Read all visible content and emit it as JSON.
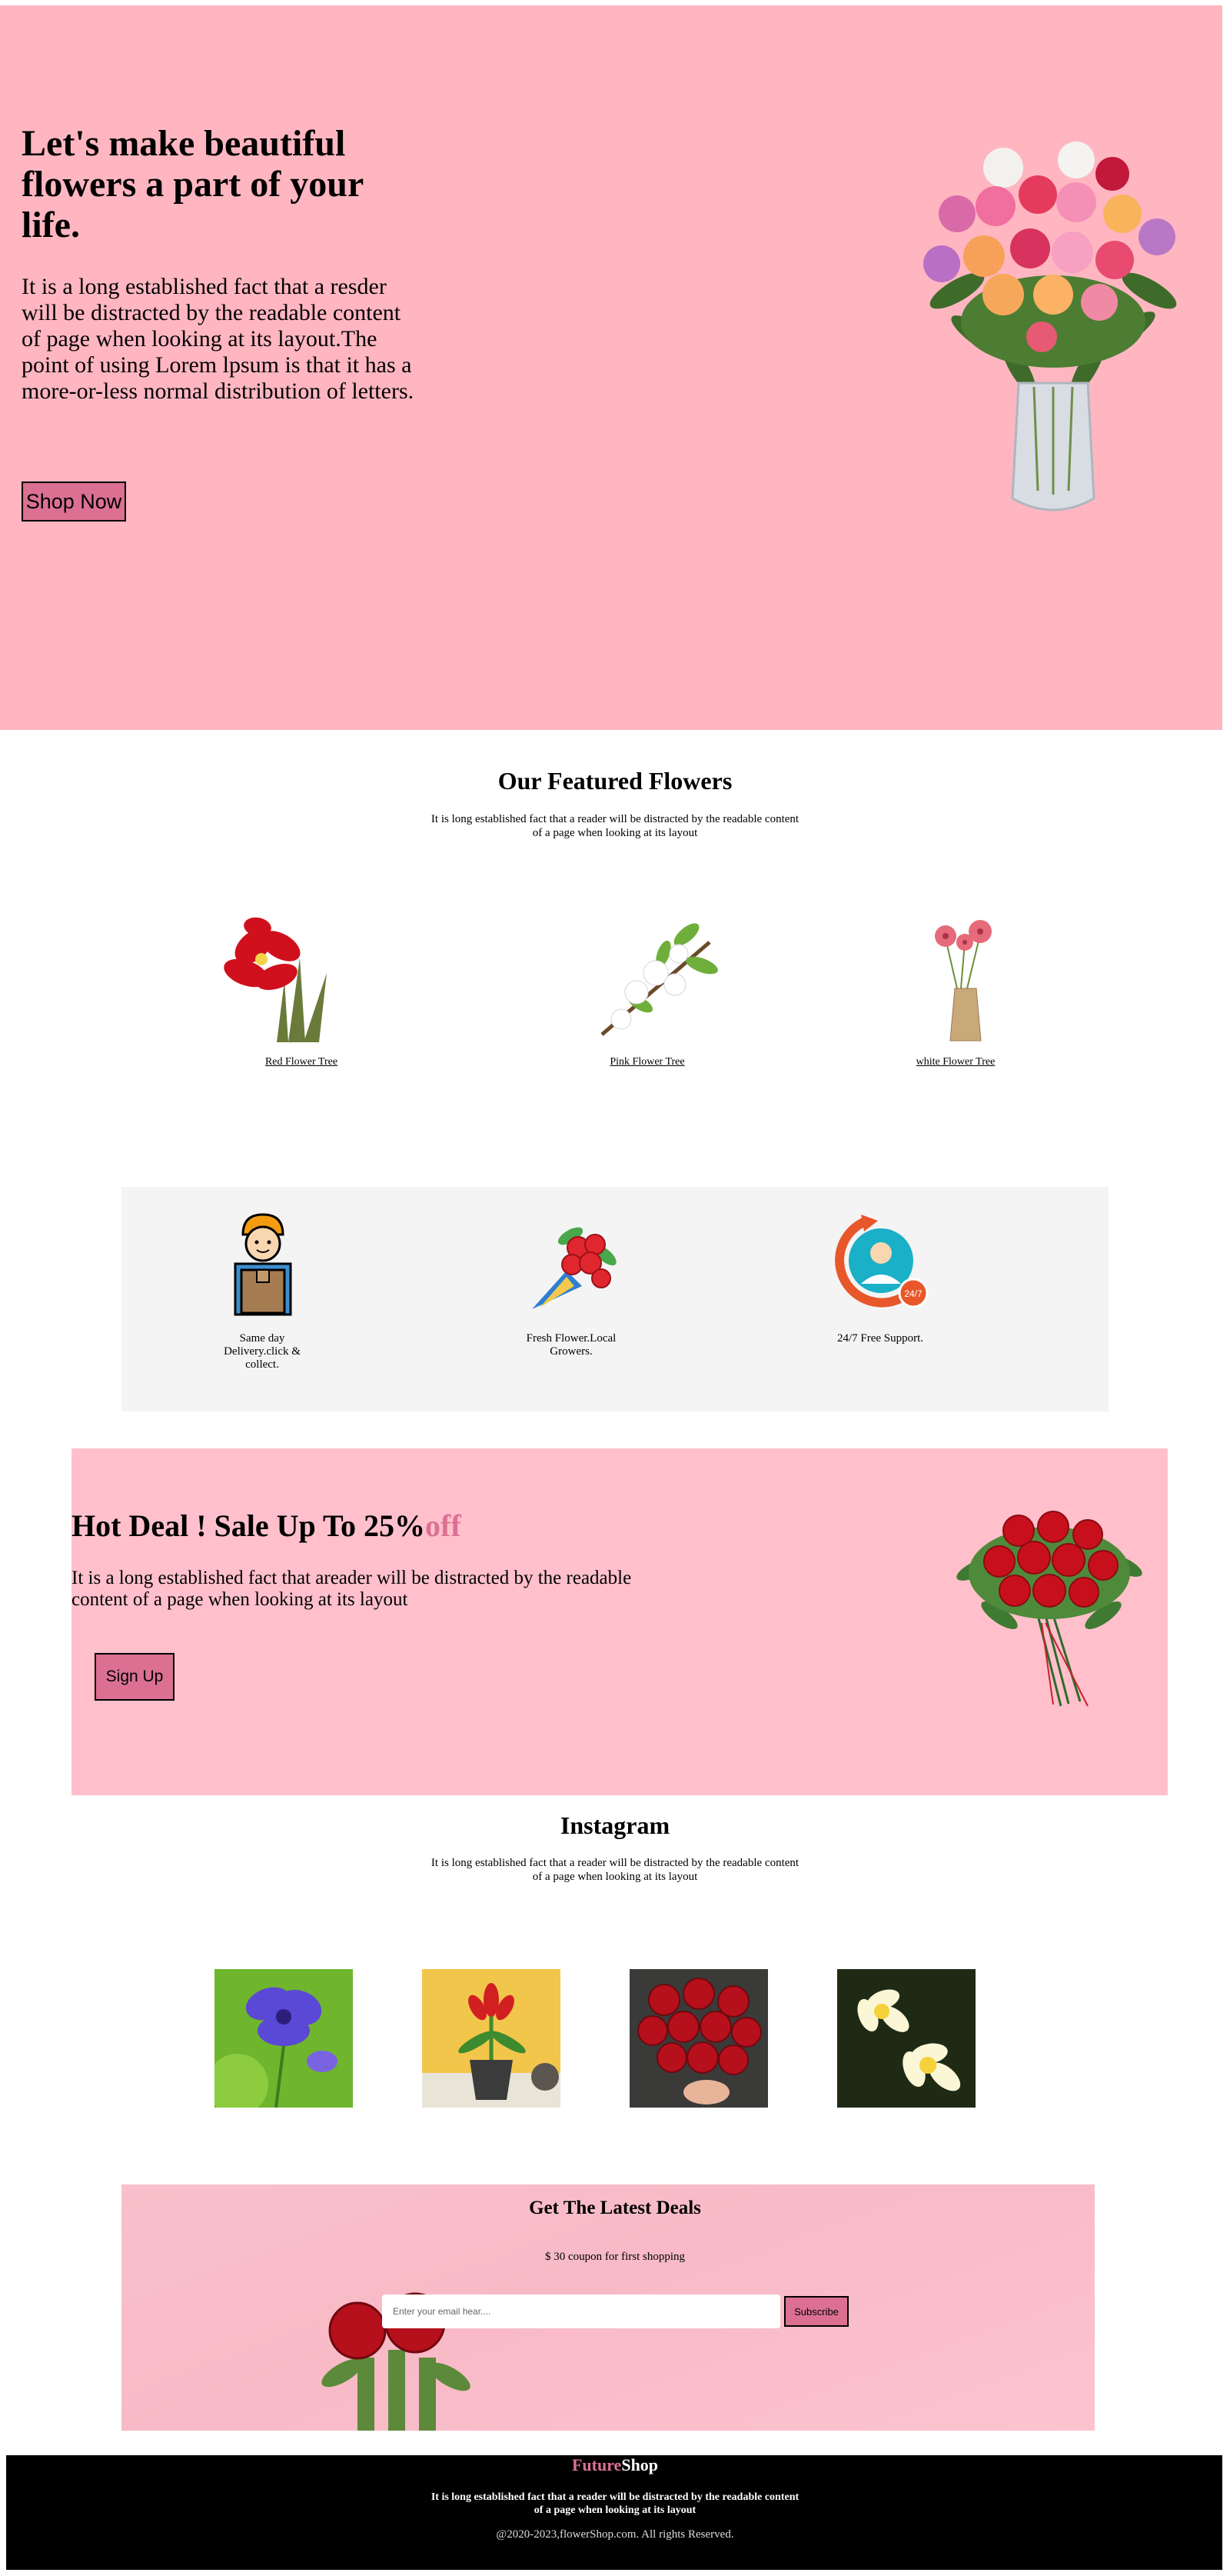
{
  "hero": {
    "title": "Let's make beautiful flowers a part of your life.",
    "text": "It is a long established fact that a resder will be distracted by the readable content of page when looking at its layout.The point of using Lorem lpsum is that it has a more-or-less normal distribution of letters.",
    "button": "Shop Now",
    "image_icon": "rose-vase-image"
  },
  "featured": {
    "title": "Our Featured Flowers",
    "subtitle": "It is long established fact that a reader will be distracted by the readable content of a page when looking at its layout",
    "items": [
      {
        "label": "Red Flower Tree",
        "icon": "red-amaryllis-image"
      },
      {
        "label": "Pink Flower Tree",
        "icon": "white-blossom-branch-image"
      },
      {
        "label": "white Flower Tree",
        "icon": "pink-gerbera-vase-image"
      }
    ]
  },
  "features": {
    "items": [
      {
        "label": "Same day Delivery.click & collect.",
        "icon": "delivery-man-icon"
      },
      {
        "label": "Fresh Flower.Local Growers.",
        "icon": "bouquet-icon"
      },
      {
        "label": "24/7 Free Support.",
        "icon": "support-24-7-icon"
      }
    ]
  },
  "deal": {
    "title": "Hot Deal ! Sale Up To 25%",
    "title_accent": "off",
    "text": "It is a long established fact that areader will be distracted by the readable content of a page when looking at its layout",
    "button": "Sign Up",
    "image_icon": "red-rose-bouquet-image"
  },
  "instagram": {
    "title": "Instagram",
    "subtitle": "It is long established fact that a reader will be distracted by the readable content of a page when looking at its layout",
    "photos": [
      "purple-flower-photo",
      "potted-red-flower-photo",
      "red-roses-photo",
      "yellow-plumeria-photo"
    ]
  },
  "newsletter": {
    "title": "Get The Latest Deals",
    "subtitle": "$ 30 coupon for first shopping",
    "placeholder": "Enter your email hear....",
    "button": "Subscribe"
  },
  "footer": {
    "brand_part1": "Future",
    "brand_part2": "Shop",
    "text": "It is long established fact that a reader will be distracted by the readable content of a page when looking at its layout",
    "copyright": "@2020-2023,flowerShop.com. All rights Reserved."
  },
  "colors": {
    "hero_bg": "#ffb6c1",
    "deal_bg": "#ffc0cb",
    "accent": "#db7093",
    "features_bg": "#f4f4f4",
    "footer_bg": "#000000"
  }
}
